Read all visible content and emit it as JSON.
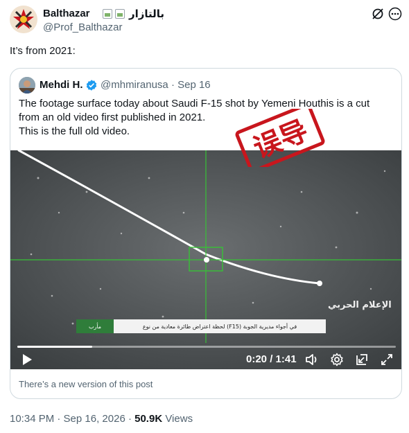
{
  "author": {
    "name": "Balthazar",
    "arabic_name": "بالتازار",
    "handle": "@Prof_Balthazar"
  },
  "tweet": {
    "text": "It’s from 2021:"
  },
  "quoted": {
    "name": "Mehdi H.",
    "handle": "@mhmiranusa",
    "date": "Sep 16",
    "text_lines": [
      "The footage surface today about Saudi F-15 shot by Yemeni Houthis is a cut from an old video first published in 2021.",
      "This is the full old video."
    ],
    "stamp_text": "误导",
    "video": {
      "watermark": "الإعلام الحربي",
      "lower_third_left": "مأرب",
      "lower_third_right": "لحظة اعتراض طائرة معادية من نوع (F15) في أجواء مديرية الجوبة",
      "time": "0:20 / 1:41",
      "progress": 0.198
    },
    "new_version_notice": "There’s a new version of this post"
  },
  "meta": {
    "timestamp": "10:34 PM · Sep 16, 2026 ·",
    "views_count": "50.9K",
    "views_label": "Views"
  },
  "colors": {
    "text": "#0f1419",
    "secondary": "#536471",
    "verified": "#1d9bf0",
    "crosshair": "#37c236",
    "stamp": "#c8161d"
  }
}
